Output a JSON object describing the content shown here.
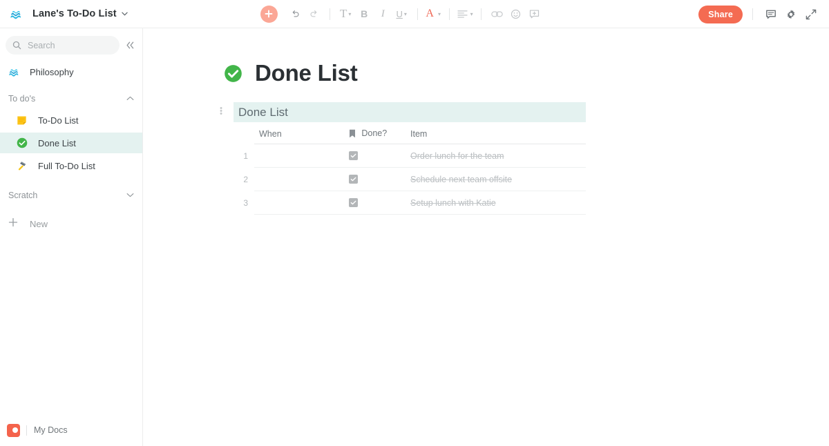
{
  "topbar": {
    "doc_icon": "waves-emoji",
    "doc_title": "Lane's To-Do List",
    "doc_caret": "⌄",
    "tools": [
      {
        "name": "add-block-button",
        "label": "+"
      },
      {
        "name": "undo-button",
        "label": "↶"
      },
      {
        "name": "redo-button",
        "label": "↷"
      },
      {
        "name": "text-style-button",
        "label": "T"
      },
      {
        "name": "bold-button",
        "label": "B"
      },
      {
        "name": "italic-button",
        "label": "I"
      },
      {
        "name": "underline-button",
        "label": "U"
      },
      {
        "name": "font-color-button",
        "label": "A"
      },
      {
        "name": "align-button",
        "label": "≡"
      },
      {
        "name": "link-button",
        "label": "⧉"
      },
      {
        "name": "emoji-button",
        "label": "☺"
      },
      {
        "name": "comment-add-button",
        "label": "⊞"
      }
    ],
    "share_label": "Share",
    "right_icons": [
      {
        "name": "comments-icon",
        "label": "comment-bubble"
      },
      {
        "name": "settings-icon",
        "label": "gear"
      },
      {
        "name": "expand-icon",
        "label": "full-screen-arrows"
      }
    ],
    "accent_color": "#f46b52",
    "plus_color": "#fba796"
  },
  "sidebar": {
    "search": {
      "placeholder": "Search",
      "value": ""
    },
    "collapse_label": "«",
    "top_item": {
      "label": "Philosophy",
      "icon": "waves-emoji"
    },
    "sections": [
      {
        "title": "To do's",
        "chevron": "⌃",
        "expanded": true,
        "items": [
          {
            "label": "To-Do List",
            "icon": "sticky-note-emoji",
            "active": false
          },
          {
            "label": "Done List",
            "icon": "green-check-emoji",
            "active": true
          },
          {
            "label": "Full To-Do List",
            "icon": "hammer-emoji",
            "active": false
          }
        ]
      },
      {
        "title": "Scratch",
        "chevron": "⌄",
        "expanded": false,
        "items": []
      }
    ],
    "new_label": "New",
    "new_plus": "+",
    "footer": {
      "label": "My Docs",
      "logo_color": "#f4634c"
    },
    "active_bg": "#e4f2f0"
  },
  "main": {
    "page_icon": "green-check-emoji",
    "page_title": "Done List",
    "table": {
      "title": "Done List",
      "title_bg": "#e4f2f0",
      "drag_handle": "⋮",
      "columns": [
        {
          "key": "when",
          "label": "When",
          "icon": null
        },
        {
          "key": "done",
          "label": "Done?",
          "icon": "bookmark-icon"
        },
        {
          "key": "item",
          "label": "Item",
          "icon": null
        }
      ],
      "rows": [
        {
          "index": "1",
          "when": "",
          "done": true,
          "item": "Order lunch for the team"
        },
        {
          "index": "2",
          "when": "",
          "done": true,
          "item": "Schedule next team offsite"
        },
        {
          "index": "3",
          "when": "",
          "done": true,
          "item": "Setup lunch with Katie"
        }
      ]
    }
  }
}
